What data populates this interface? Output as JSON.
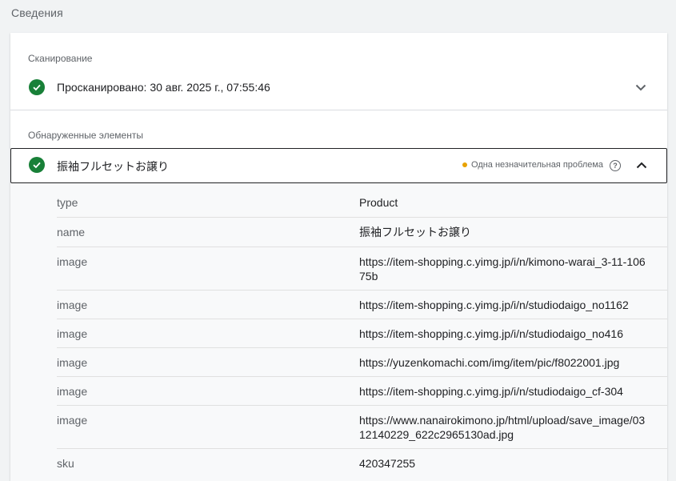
{
  "page": {
    "title": "Сведения"
  },
  "crawl": {
    "section_label": "Сканирование",
    "status_text": "Просканировано: 30 авг. 2025 г., 07:55:46",
    "status_icon": "check-circle-icon",
    "status_color": "#188038"
  },
  "detected": {
    "section_label": "Обнаруженные элементы",
    "item": {
      "title": "振袖フルセットお譲り",
      "issue_text": "Одна незначительная проблема",
      "issue_color": "#e8a200",
      "help_icon": "help-circle-icon",
      "expanded": true
    },
    "properties": [
      {
        "key": "type",
        "value": "Product"
      },
      {
        "key": "name",
        "value": "振袖フルセットお譲り"
      },
      {
        "key": "image",
        "value": "https://item-shopping.c.yimg.jp/i/n/kimono-warai_3-11-10675b"
      },
      {
        "key": "image",
        "value": "https://item-shopping.c.yimg.jp/i/n/studiodaigo_no1162"
      },
      {
        "key": "image",
        "value": "https://item-shopping.c.yimg.jp/i/n/studiodaigo_no416"
      },
      {
        "key": "image",
        "value": "https://yuzenkomachi.com/img/item/pic/f8022001.jpg"
      },
      {
        "key": "image",
        "value": "https://item-shopping.c.yimg.jp/i/n/studiodaigo_cf-304"
      },
      {
        "key": "image",
        "value": "https://www.nanairokimono.jp/html/upload/save_image/0312140229_622c2965130ad.jpg"
      },
      {
        "key": "sku",
        "value": "420347255"
      }
    ]
  }
}
